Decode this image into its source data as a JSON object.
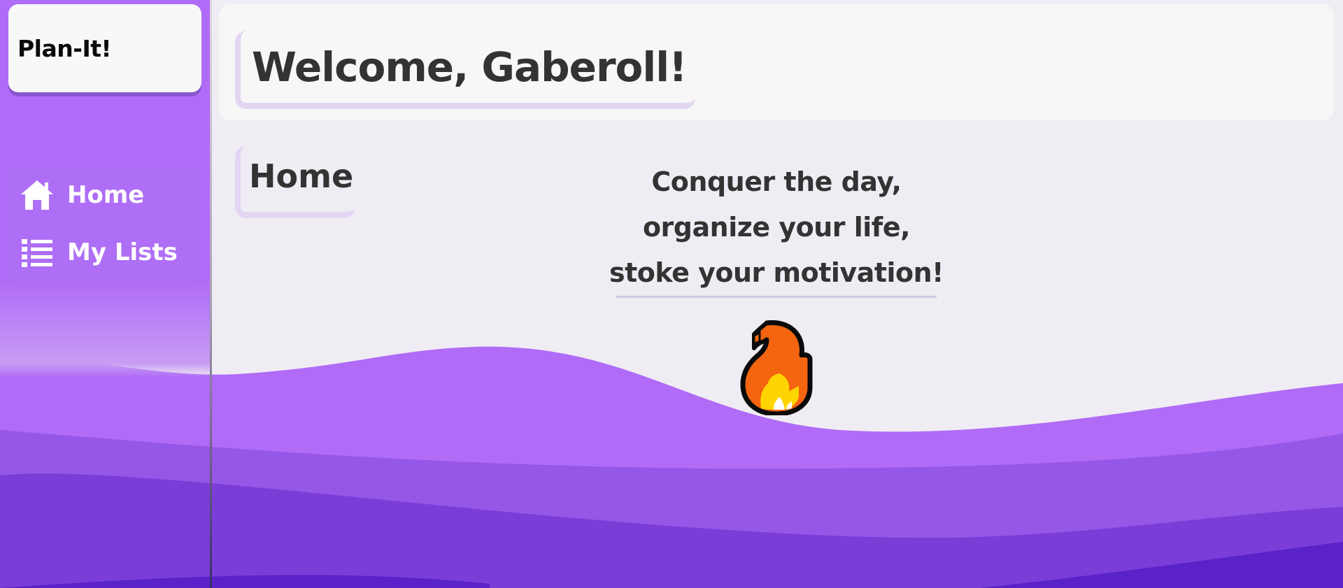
{
  "app": {
    "brand": "Plan-It!"
  },
  "sidebar": {
    "items": [
      {
        "label": "Home",
        "icon": "home-icon"
      },
      {
        "label": "My Lists",
        "icon": "list-icon"
      }
    ]
  },
  "header": {
    "welcome": "Welcome, Gaberoll!"
  },
  "main": {
    "page_title": "Home",
    "tagline": [
      "Conquer the day,",
      "organize your life,",
      "stoke your motivation!"
    ],
    "mascot_icon": "fire-icon"
  },
  "colors": {
    "accent_purple": "#b06bf7",
    "wave_mid": "#9656e6",
    "wave_dark": "#7a3dd8",
    "wave_darkest": "#5a22c8",
    "card_bg": "#f7f7f7",
    "page_bg": "#efedf3",
    "text_dark": "#333333",
    "card_border": "#e3d6f3"
  }
}
